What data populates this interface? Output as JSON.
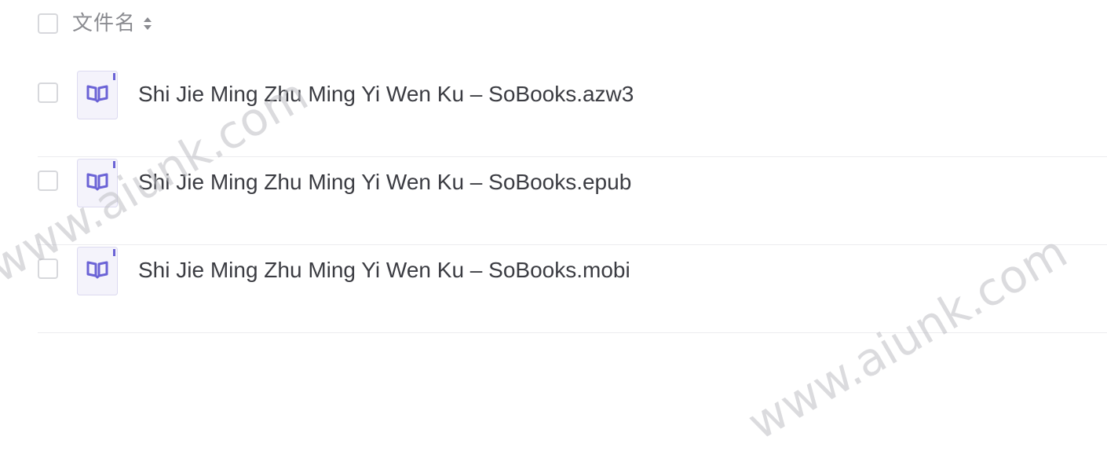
{
  "header": {
    "column_label": "文件名",
    "sort_icon": "sort-icon"
  },
  "files": [
    {
      "name": "Shi Jie Ming Zhu Ming Yi Wen Ku – SoBooks.azw3",
      "icon": "book-icon"
    },
    {
      "name": "Shi Jie Ming Zhu Ming Yi Wen Ku – SoBooks.epub",
      "icon": "book-icon"
    },
    {
      "name": "Shi Jie Ming Zhu Ming Yi Wen Ku – SoBooks.mobi",
      "icon": "book-icon"
    }
  ],
  "watermark": {
    "text": "www.aiunk.com"
  },
  "colors": {
    "icon_accent": "#6b63d6",
    "icon_background": "#f4f3fb",
    "checkbox_border": "#d7d8dc",
    "divider": "#ececef"
  }
}
